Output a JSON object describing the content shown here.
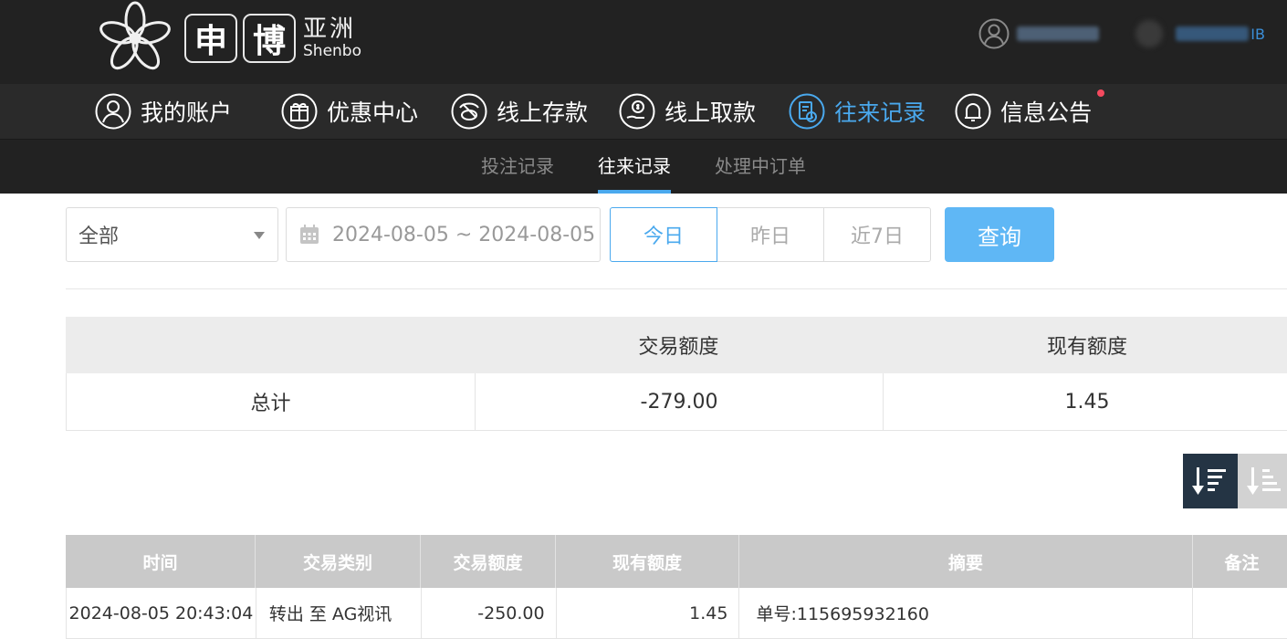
{
  "brand": {
    "box1": "申",
    "box2": "博",
    "cn": "亚洲",
    "en": "Shenbo"
  },
  "user": {
    "suffix": "IB"
  },
  "nav": [
    {
      "label": "我的账户",
      "icon": "user-icon"
    },
    {
      "label": "优惠中心",
      "icon": "gift-icon"
    },
    {
      "label": "线上存款",
      "icon": "deposit-icon"
    },
    {
      "label": "线上取款",
      "icon": "withdraw-icon"
    },
    {
      "label": "往来记录",
      "icon": "records-icon",
      "active": true
    },
    {
      "label": "信息公告",
      "icon": "bell-icon",
      "badge": true
    }
  ],
  "subnav": [
    {
      "label": "投注记录"
    },
    {
      "label": "往来记录",
      "active": true
    },
    {
      "label": "处理中订单"
    }
  ],
  "filter": {
    "type_value": "全部",
    "date_range": "2024-08-05 ~ 2024-08-05",
    "quick": [
      "今日",
      "昨日",
      "近7日"
    ],
    "quick_active": "今日",
    "query_label": "查询"
  },
  "summary": {
    "headers": [
      "",
      "交易额度",
      "现有额度"
    ],
    "row": [
      "总计",
      "-279.00",
      "1.45"
    ]
  },
  "records": {
    "headers": [
      "时间",
      "交易类别",
      "交易额度",
      "现有额度",
      "摘要",
      "备注"
    ],
    "rows": [
      [
        "2024-08-05 20:43:04",
        "转出 至 AG视讯",
        "-250.00",
        "1.45",
        "单号:115695932160",
        ""
      ]
    ]
  },
  "colors": {
    "accent": "#4aa9ee",
    "header_bg": "#222222",
    "nav_bg": "#2a2a2a",
    "query_btn": "#5fb7f5",
    "badge": "#f44a5f"
  }
}
